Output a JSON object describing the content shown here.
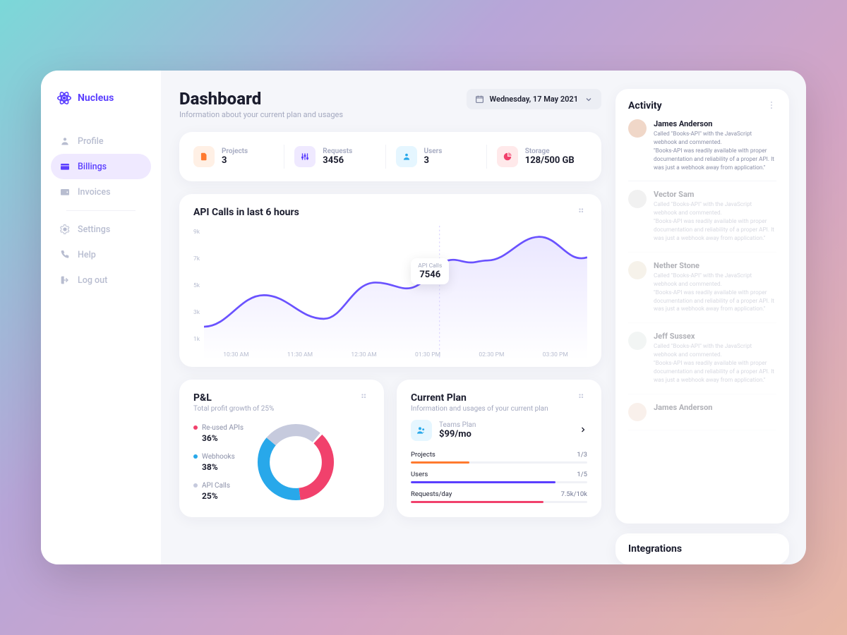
{
  "brand": {
    "name": "Nucleus"
  },
  "sidebar": {
    "items": [
      {
        "label": "Profile",
        "icon": "user-icon"
      },
      {
        "label": "Billings",
        "icon": "card-icon",
        "active": true
      },
      {
        "label": "Invoices",
        "icon": "wallet-icon"
      },
      {
        "label": "Settings",
        "icon": "gear-icon"
      },
      {
        "label": "Help",
        "icon": "phone-icon"
      },
      {
        "label": "Log out",
        "icon": "logout-icon"
      }
    ]
  },
  "header": {
    "title": "Dashboard",
    "subtitle": "Information about your current plan and usages",
    "date": "Wednesday, 17 May 2021"
  },
  "stats": [
    {
      "label": "Projects",
      "value": "3",
      "tone": "orange",
      "icon": "file-icon"
    },
    {
      "label": "Requests",
      "value": "3456",
      "tone": "purple",
      "icon": "sliders-icon"
    },
    {
      "label": "Users",
      "value": "3",
      "tone": "blue",
      "icon": "person-icon"
    },
    {
      "label": "Storage",
      "value": "128/500 GB",
      "tone": "red",
      "icon": "pie-icon"
    }
  ],
  "chart": {
    "title": "API Calls in last 6 hours",
    "tooltip_label": "API Calls",
    "tooltip_value": "7546"
  },
  "chart_data": {
    "type": "line",
    "x": [
      "10:30 AM",
      "11:30 AM",
      "12:30 AM",
      "01:30 PM",
      "02:30 PM",
      "03:30 PM"
    ],
    "y_ticks": [
      "9k",
      "7k",
      "5k",
      "3k",
      "1k"
    ],
    "series": [
      {
        "name": "API Calls",
        "values": [
          2500,
          5200,
          4200,
          6800,
          7546,
          9200
        ],
        "marker_index": 4,
        "marker_value": 7546
      }
    ],
    "ylim": [
      0,
      10000
    ]
  },
  "pnl": {
    "title": "P&L",
    "subtitle": "Total profit growth of 25%",
    "segments": [
      {
        "label": "Re-used APIs",
        "pct": "36%",
        "value": 36,
        "color": "#f1416c"
      },
      {
        "label": "Webhooks",
        "pct": "38%",
        "value": 38,
        "color": "#28a8ea"
      },
      {
        "label": "API Calls",
        "pct": "25%",
        "value": 25,
        "color": "#c6cadd"
      }
    ]
  },
  "plan": {
    "title": "Current Plan",
    "subtitle": "Information and usages of your current plan",
    "name": "Teams Plan",
    "price": "$99/mo",
    "usages": [
      {
        "label": "Projects",
        "value": "1/3",
        "pct": 33,
        "color": "#ff7a2f"
      },
      {
        "label": "Users",
        "value": "1/5",
        "pct": 82,
        "color": "#5b3fff"
      },
      {
        "label": "Requests/day",
        "value": "7.5k/10k",
        "pct": 75,
        "color": "#f1416c"
      }
    ]
  },
  "activity": {
    "title": "Activity",
    "items": [
      {
        "name": "James Anderson",
        "desc": "Called \"Books-API\" with the JavaScript webhook and commented.\n\"Books-API was readily available with proper documentation and reliability of a proper API. It was just a webhook away from application.\"",
        "faded": false
      },
      {
        "name": "Vector Sam",
        "desc": "Called \"Books-API\" with the JavaScript webhook and commented.\n\"Books-API was readily available with proper documentation and reliability of a proper API. It was just a webhook away from application.\"",
        "faded": true
      },
      {
        "name": "Nether Stone",
        "desc": "Called \"Books-API\" with the JavaScript webhook and commented.\n\"Books-API was readily available with proper documentation and reliability of a proper API. It was just a webhook away from application.\"",
        "faded": true
      },
      {
        "name": "Jeff Sussex",
        "desc": "Called \"Books-API\" with the JavaScript webhook and commented.\n\"Books-API was readily available with proper documentation and reliability of a proper API. It was just a webhook away from application.\"",
        "faded": true
      },
      {
        "name": "James Anderson",
        "desc": "",
        "faded": true
      }
    ]
  },
  "integrations": {
    "title": "Integrations"
  },
  "colors": {
    "accent": "#5b3fff"
  }
}
